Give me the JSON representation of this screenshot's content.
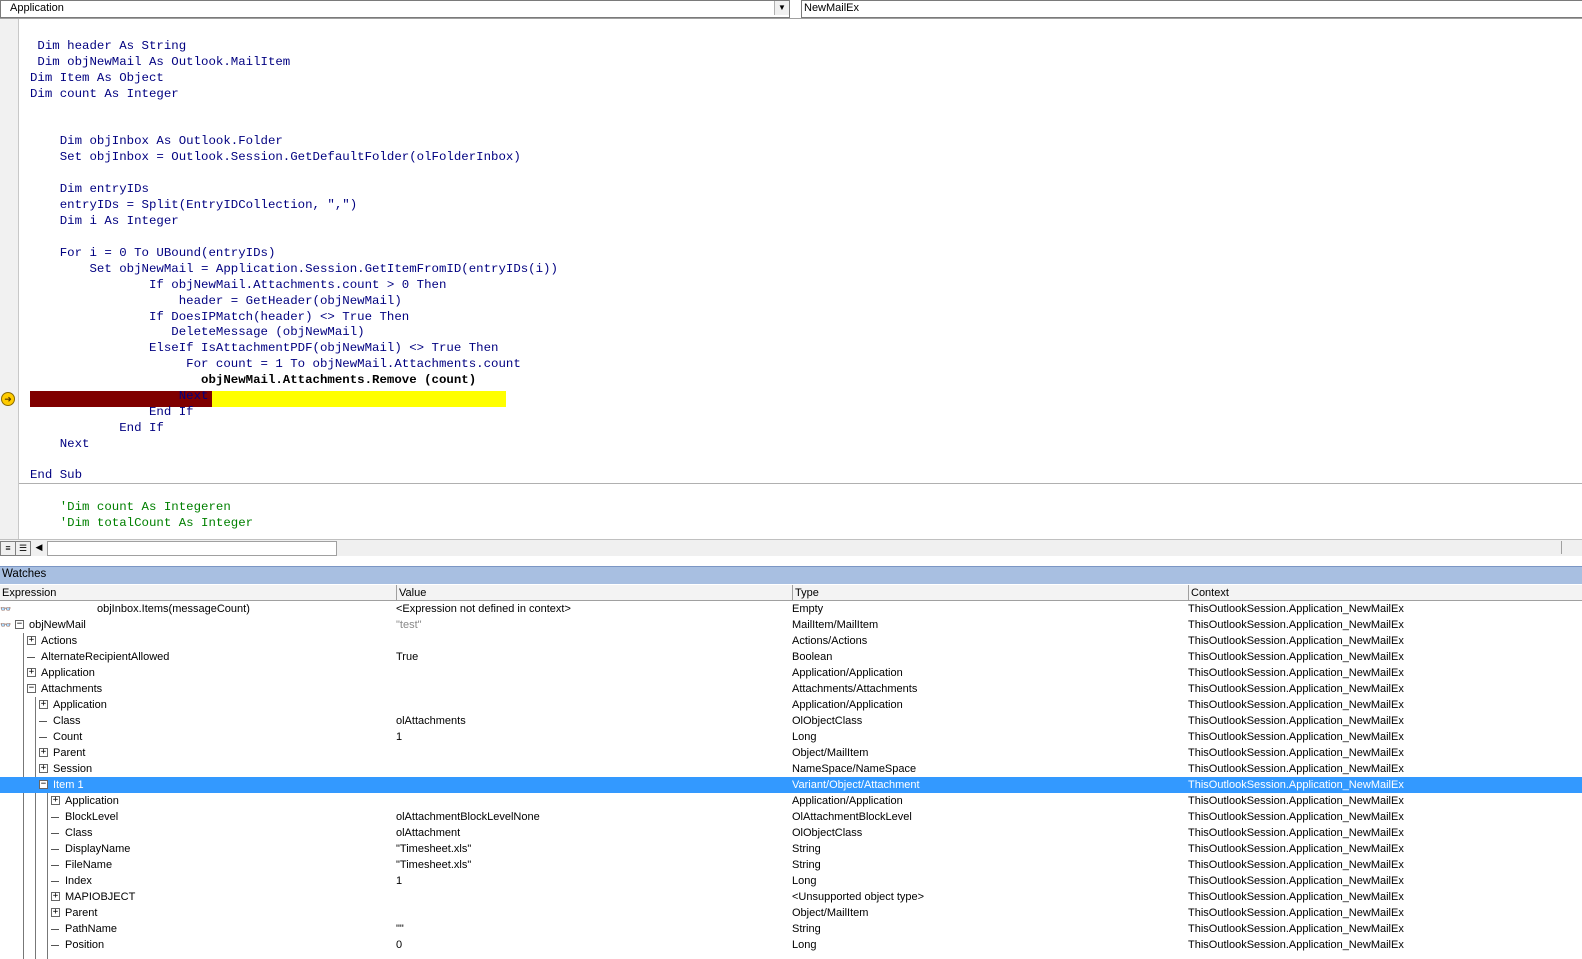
{
  "combos": {
    "object": "Application",
    "procedure": "NewMailEx"
  },
  "code": {
    "lines": [
      " Dim header As String",
      " Dim objNewMail As Outlook.MailItem",
      "Dim Item As Object",
      "Dim count As Integer",
      "",
      "",
      "    Dim objInbox As Outlook.Folder",
      "    Set objInbox = Outlook.Session.GetDefaultFolder(olFolderInbox)",
      "",
      "    Dim entryIDs",
      "    entryIDs = Split(EntryIDCollection, \",\")",
      "    Dim i As Integer",
      "",
      "    For i = 0 To UBound(entryIDs)",
      "        Set objNewMail = Application.Session.GetItemFromID(entryIDs(i))",
      "                If objNewMail.Attachments.count > 0 Then",
      "                    header = GetHeader(objNewMail)",
      "                If DoesIPMatch(header) <> True Then",
      "                   DeleteMessage (objNewMail)",
      "                ElseIf IsAttachmentPDF(objNewMail) <> True Then",
      "                     For count = 1 To objNewMail.Attachments.count",
      "                       objNewMail.Attachments.Remove (count)",
      "                    Next",
      "                End If",
      "            End If",
      "    Next",
      "",
      "End Sub"
    ],
    "comments": [
      "    'Dim count As Integeren",
      "    'Dim totalCount As Integer"
    ]
  },
  "watches": {
    "title": "Watches",
    "columns": [
      "Expression",
      "Value",
      "Type",
      "Context"
    ],
    "rows": [
      {
        "expr": "objInbox.Items(messageCount)",
        "value": "<Expression not defined in context>",
        "type": "Empty",
        "context": "ThisOutlookSession.Application_NewMailEx"
      },
      {
        "expr": "objNewMail",
        "value": "\"test\"",
        "type": "MailItem/MailItem",
        "context": "ThisOutlookSession.Application_NewMailEx"
      },
      {
        "expr": "Actions",
        "value": "",
        "type": "Actions/Actions",
        "context": "ThisOutlookSession.Application_NewMailEx"
      },
      {
        "expr": "AlternateRecipientAllowed",
        "value": "True",
        "type": "Boolean",
        "context": "ThisOutlookSession.Application_NewMailEx"
      },
      {
        "expr": "Application",
        "value": "",
        "type": "Application/Application",
        "context": "ThisOutlookSession.Application_NewMailEx"
      },
      {
        "expr": "Attachments",
        "value": "",
        "type": "Attachments/Attachments",
        "context": "ThisOutlookSession.Application_NewMailEx"
      },
      {
        "expr": "Application",
        "value": "",
        "type": "Application/Application",
        "context": "ThisOutlookSession.Application_NewMailEx"
      },
      {
        "expr": "Class",
        "value": "olAttachments",
        "type": "OlObjectClass",
        "context": "ThisOutlookSession.Application_NewMailEx"
      },
      {
        "expr": "Count",
        "value": "1",
        "type": "Long",
        "context": "ThisOutlookSession.Application_NewMailEx"
      },
      {
        "expr": "Parent",
        "value": "",
        "type": "Object/MailItem",
        "context": "ThisOutlookSession.Application_NewMailEx"
      },
      {
        "expr": "Session",
        "value": "",
        "type": "NameSpace/NameSpace",
        "context": "ThisOutlookSession.Application_NewMailEx"
      },
      {
        "expr": "Item 1",
        "value": "",
        "type": "Variant/Object/Attachment",
        "context": "ThisOutlookSession.Application_NewMailEx"
      },
      {
        "expr": "Application",
        "value": "",
        "type": "Application/Application",
        "context": "ThisOutlookSession.Application_NewMailEx"
      },
      {
        "expr": "BlockLevel",
        "value": "olAttachmentBlockLevelNone",
        "type": "OlAttachmentBlockLevel",
        "context": "ThisOutlookSession.Application_NewMailEx"
      },
      {
        "expr": "Class",
        "value": "olAttachment",
        "type": "OlObjectClass",
        "context": "ThisOutlookSession.Application_NewMailEx"
      },
      {
        "expr": "DisplayName",
        "value": "\"Timesheet.xls\"",
        "type": "String",
        "context": "ThisOutlookSession.Application_NewMailEx"
      },
      {
        "expr": "FileName",
        "value": "\"Timesheet.xls\"",
        "type": "String",
        "context": "ThisOutlookSession.Application_NewMailEx"
      },
      {
        "expr": "Index",
        "value": "1",
        "type": "Long",
        "context": "ThisOutlookSession.Application_NewMailEx"
      },
      {
        "expr": "MAPIOBJECT",
        "value": "",
        "type": "<Unsupported object type>",
        "context": "ThisOutlookSession.Application_NewMailEx"
      },
      {
        "expr": "Parent",
        "value": "",
        "type": "Object/MailItem",
        "context": "ThisOutlookSession.Application_NewMailEx"
      },
      {
        "expr": "PathName",
        "value": "\"\"",
        "type": "String",
        "context": "ThisOutlookSession.Application_NewMailEx"
      },
      {
        "expr": "Position",
        "value": "0",
        "type": "Long",
        "context": "ThisOutlookSession.Application_NewMailEx"
      }
    ]
  }
}
